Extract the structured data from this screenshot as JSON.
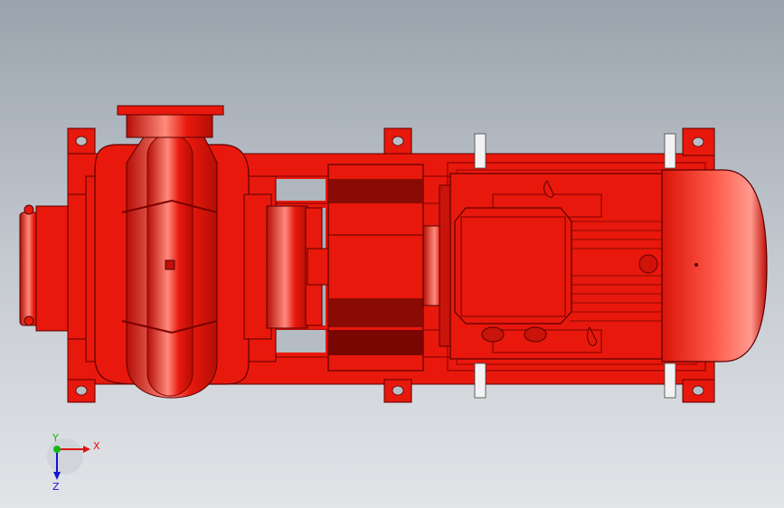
{
  "viewport": {
    "background_top": "#9aa3ad",
    "background_bottom": "#e2e4e8"
  },
  "model": {
    "part_color": "#e8180c",
    "part_highlight": "#ff7a6e",
    "part_shadow": "#9c0c05",
    "bolt_color": "#f2f2f2",
    "edge_color": "#5a0000"
  },
  "triad": {
    "x_label": "X",
    "y_label": "Y",
    "z_label": "Z",
    "x_color": "#e01010",
    "y_color": "#14b814",
    "z_color": "#1414d0"
  }
}
